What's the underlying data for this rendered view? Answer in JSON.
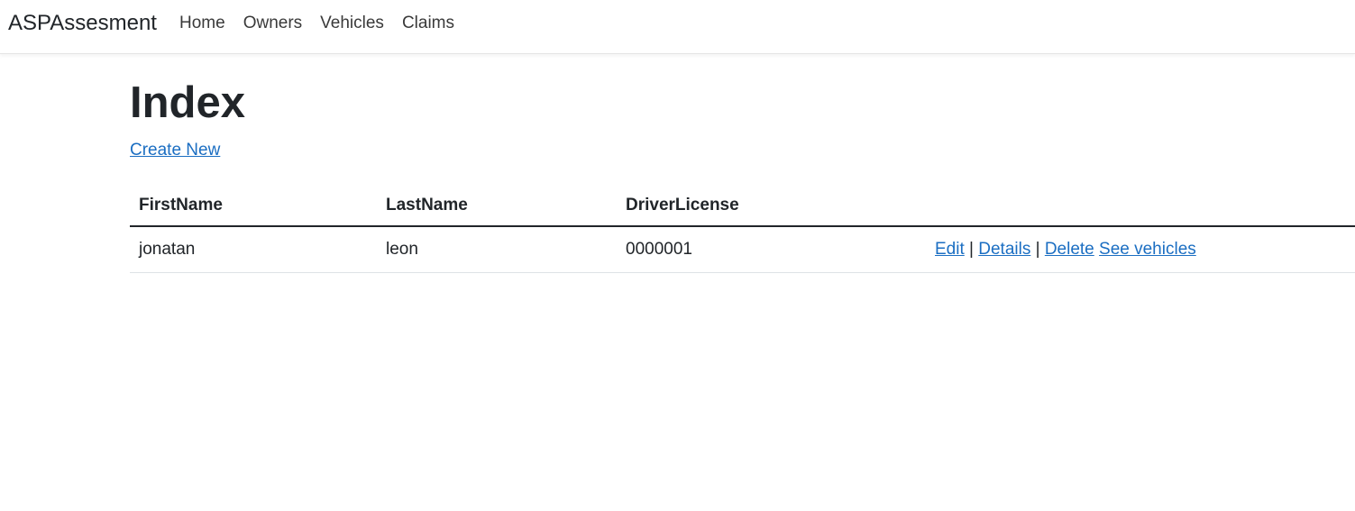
{
  "navbar": {
    "brand": "ASPAssesment",
    "links": [
      "Home",
      "Owners",
      "Vehicles",
      "Claims"
    ]
  },
  "page": {
    "title": "Index",
    "create_new": "Create New"
  },
  "table": {
    "headers": [
      "FirstName",
      "LastName",
      "DriverLicense",
      ""
    ],
    "rows": [
      {
        "first_name": "jonatan",
        "last_name": "leon",
        "driver_license": "0000001",
        "actions": {
          "edit": "Edit",
          "details": "Details",
          "delete": "Delete",
          "see_vehicles": "See vehicles",
          "separator": "|"
        }
      }
    ]
  },
  "colors": {
    "link": "#1b6ec2",
    "text": "#212529"
  }
}
